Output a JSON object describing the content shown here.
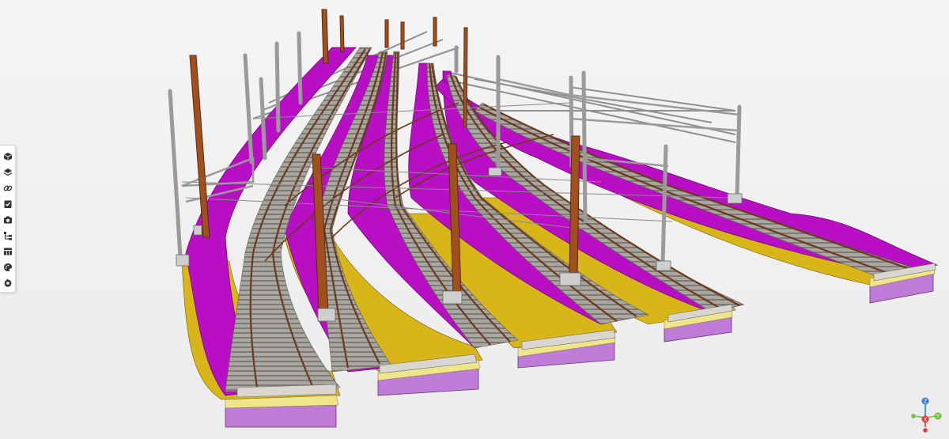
{
  "toolbar": {
    "items": [
      {
        "name": "cube-icon"
      },
      {
        "name": "layers-icon"
      },
      {
        "name": "link-icon"
      },
      {
        "name": "checklist-icon"
      },
      {
        "name": "camera-icon"
      },
      {
        "name": "tree-icon"
      },
      {
        "name": "table-icon"
      },
      {
        "name": "palette-icon"
      },
      {
        "name": "gear-icon"
      }
    ]
  },
  "gizmo": {
    "z_label": "Z",
    "x_label": "X",
    "y_label": "Y",
    "colors": {
      "z": "#2d7fd6",
      "x": "#e23a3a",
      "y": "#6cc23a"
    }
  },
  "scene_colors": {
    "magenta": "#b80ec4",
    "yellow": "#d8b61a",
    "pale_yellow": "#efe68c",
    "lavender": "#c07ad8",
    "ballast_grey": "#9c9a94",
    "rail_brown": "#6b3a1c",
    "mast_orange": "#a0501e",
    "steel_grey": "#9a9a9a"
  }
}
